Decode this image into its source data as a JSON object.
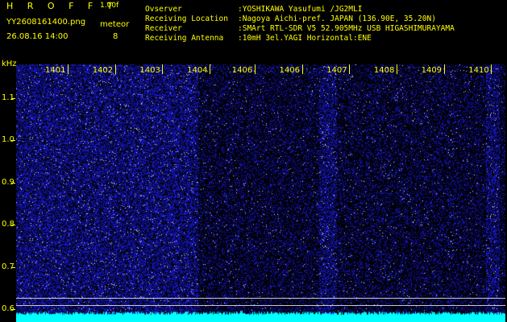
{
  "header": {
    "app_title": "HROFFT",
    "app_version": "1.00f",
    "filename": "YY2608161400.png",
    "datetime": "26.08.16 14:00",
    "meteor_label": "meteor",
    "meteor_count": "8"
  },
  "info": [
    {
      "key": "Ovserver",
      "value": ":YOSHIKAWA Yasufumi /JG2MLI"
    },
    {
      "key": "Receiving Location",
      "value": ":Nagoya Aichi-pref. JAPAN (136.90E, 35.20N)"
    },
    {
      "key": "Receiver",
      "value": ":SMArt RTL-SDR V5 52.905MHz USB HIGASHIMURAYAMA"
    },
    {
      "key": "Receiving Antenna",
      "value": ":10mH 3el.YAGI Horizontal:ENE"
    }
  ],
  "y_axis": {
    "unit": "kHz",
    "ticks": [
      {
        "label": "1.1",
        "value": 1.1
      },
      {
        "label": "1.0",
        "value": 1.0
      },
      {
        "label": "0.9",
        "value": 0.9
      },
      {
        "label": "0.8",
        "value": 0.8
      },
      {
        "label": "0.7",
        "value": 0.7
      },
      {
        "label": "0.6",
        "value": 0.6
      }
    ],
    "range": [
      0.57,
      1.18
    ]
  },
  "x_axis": {
    "ticks": [
      "1401",
      "1402",
      "1403",
      "1404",
      "1406",
      "1406",
      "1407",
      "1408",
      "1409",
      "1410"
    ]
  },
  "colors": {
    "background": "#000000",
    "label_text": "#ffff00",
    "info_text": "#ffff00",
    "spectrogram_noise": "#1a1aff",
    "baseline_band": "#00ffff",
    "reference_lines": "#c8c8c8"
  }
}
